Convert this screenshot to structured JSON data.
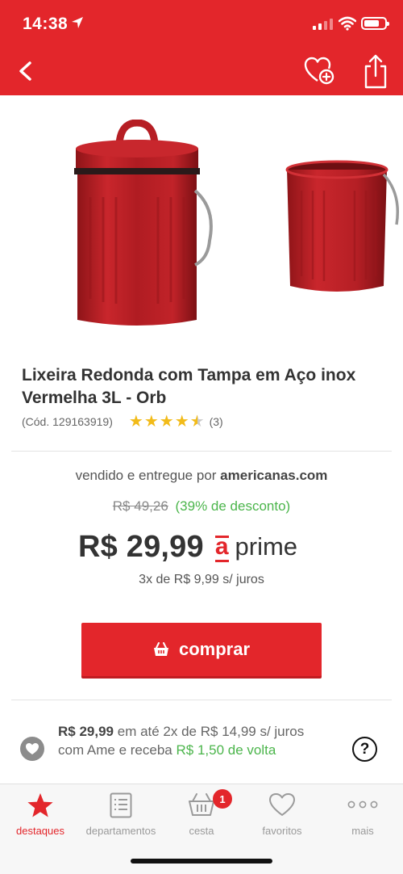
{
  "status_bar": {
    "time": "14:38"
  },
  "product": {
    "title": "Lixeira Redonda com Tampa em Aço inox Vermelha 3L - Orb",
    "code": "(Cód. 129163919)",
    "rating": 4.5,
    "rating_count": "(3)"
  },
  "offer": {
    "seller_prefix": "vendido e entregue por",
    "seller_name": "americanas.com",
    "old_price": "R$ 49,26",
    "discount": "(39% de desconto)",
    "price": "R$ 29,99",
    "prime_mark": "a",
    "prime_word": "prime",
    "installments": "3x de R$ 9,99 s/ juros",
    "buy_label": "comprar"
  },
  "ame": {
    "price": "R$ 29,99",
    "text1": "em até 2x de R$ 14,99 s/ juros com Ame e receba",
    "cashback": "R$ 1,50 de volta",
    "help": "?"
  },
  "tabbar": {
    "tabs": [
      {
        "label": "destaques",
        "icon": "star-icon",
        "active": true
      },
      {
        "label": "departamentos",
        "icon": "list-icon",
        "active": false
      },
      {
        "label": "cesta",
        "icon": "basket-icon",
        "active": false,
        "badge": "1"
      },
      {
        "label": "favoritos",
        "icon": "heart-icon",
        "active": false
      },
      {
        "label": "mais",
        "icon": "more-dots-icon",
        "active": false
      }
    ]
  },
  "colors": {
    "brand_red": "#e3262b",
    "discount_green": "#4bb54b"
  }
}
